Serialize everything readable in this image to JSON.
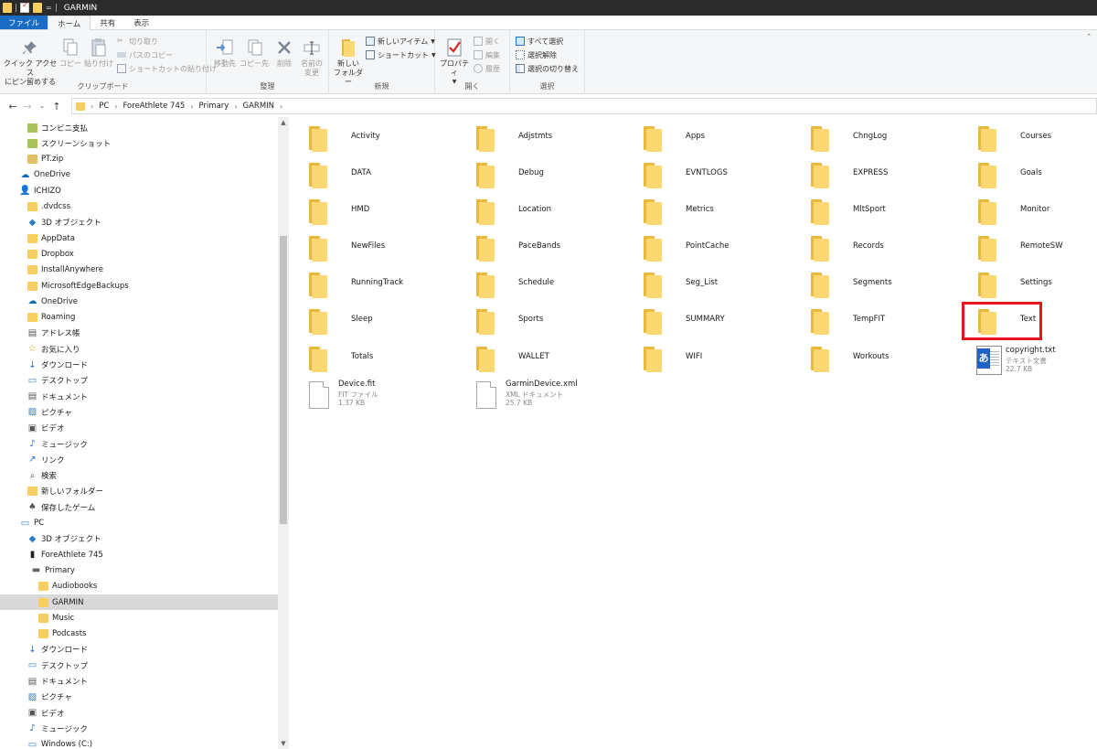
{
  "window": {
    "title": "GARMIN",
    "quick_access_down": "="
  },
  "tabs": [
    {
      "label": "ファイル"
    },
    {
      "label": "ホーム"
    },
    {
      "label": "共有"
    },
    {
      "label": "表示"
    }
  ],
  "ribbon": {
    "clipboard": {
      "label": "クリップボード",
      "pin": "クイック アクセス\nにピン留めする",
      "pin_line1": "クイック アクセス",
      "pin_line2": "にピン留めする",
      "copy": "コピー",
      "paste": "貼り付け",
      "cut": "切り取り",
      "copy_path": "パスのコピー",
      "paste_shortcut": "ショートカットの貼り付け"
    },
    "organize": {
      "label": "整理",
      "move_to": "移動先",
      "copy_to": "コピー先",
      "delete": "削除",
      "rename_line1": "名前の",
      "rename_line2": "変更"
    },
    "new": {
      "label": "新規",
      "new_folder_line1": "新しい",
      "new_folder_line2": "フォルダー",
      "new_item": "新しいアイテム",
      "shortcut": "ショートカット"
    },
    "open": {
      "label": "開く",
      "properties": "プロパティ",
      "open": "開く",
      "edit": "編集",
      "history": "履歴"
    },
    "select": {
      "label": "選択",
      "select_all": "すべて選択",
      "select_none": "選択解除",
      "invert": "選択の切り替え"
    }
  },
  "address": {
    "crumbs": [
      "PC",
      "ForeAthlete 745",
      "Primary",
      "GARMIN"
    ]
  },
  "nav": [
    {
      "label": "コンビニ支払",
      "icon": "file-icon"
    },
    {
      "label": "スクリーンショット",
      "icon": "file-icon"
    },
    {
      "label": "PT.zip",
      "icon": "zip-icon"
    },
    {
      "label": "OneDrive",
      "icon": "cloud-icon"
    },
    {
      "label": "ICHIZO",
      "icon": "user-icon"
    },
    {
      "label": ".dvdcss",
      "icon": "folder-icon"
    },
    {
      "label": "3D オブジェクト",
      "icon": "cube-icon"
    },
    {
      "label": "AppData",
      "icon": "folder-icon"
    },
    {
      "label": "Dropbox",
      "icon": "folder-icon"
    },
    {
      "label": "InstallAnywhere",
      "icon": "folder-icon"
    },
    {
      "label": "MicrosoftEdgeBackups",
      "icon": "folder-icon"
    },
    {
      "label": "OneDrive",
      "icon": "cloud-icon"
    },
    {
      "label": "Roaming",
      "icon": "folder-icon"
    },
    {
      "label": "アドレス帳",
      "icon": "contacts-icon"
    },
    {
      "label": "お気に入り",
      "icon": "star-icon"
    },
    {
      "label": "ダウンロード",
      "icon": "download-icon"
    },
    {
      "label": "デスクトップ",
      "icon": "desktop-icon"
    },
    {
      "label": "ドキュメント",
      "icon": "documents-icon"
    },
    {
      "label": "ピクチャ",
      "icon": "pictures-icon"
    },
    {
      "label": "ビデオ",
      "icon": "video-icon"
    },
    {
      "label": "ミュージック",
      "icon": "music-icon"
    },
    {
      "label": "リンク",
      "icon": "link-icon"
    },
    {
      "label": "検索",
      "icon": "search-icon"
    },
    {
      "label": "新しいフォルダー",
      "icon": "folder-icon"
    },
    {
      "label": "保存したゲーム",
      "icon": "game-icon"
    },
    {
      "label": "PC",
      "icon": "pc-icon"
    },
    {
      "label": "3D オブジェクト",
      "icon": "cube-icon"
    },
    {
      "label": "ForeAthlete 745",
      "icon": "device-icon"
    },
    {
      "label": "Primary",
      "icon": "drive-icon"
    },
    {
      "label": "Audiobooks",
      "icon": "folder-icon"
    },
    {
      "label": "GARMIN",
      "icon": "folder-icon",
      "selected": true
    },
    {
      "label": "Music",
      "icon": "folder-icon"
    },
    {
      "label": "Podcasts",
      "icon": "folder-icon"
    },
    {
      "label": "ダウンロード",
      "icon": "download-icon"
    },
    {
      "label": "デスクトップ",
      "icon": "desktop-icon"
    },
    {
      "label": "ドキュメント",
      "icon": "documents-icon"
    },
    {
      "label": "ピクチャ",
      "icon": "pictures-icon"
    },
    {
      "label": "ビデオ",
      "icon": "video-icon"
    },
    {
      "label": "ミュージック",
      "icon": "music-icon"
    },
    {
      "label": "Windows (C:)",
      "icon": "windows-drive-icon"
    }
  ],
  "folders": [
    "Activity",
    "Adjstmts",
    "Apps",
    "ChngLog",
    "Courses",
    "DATA",
    "Debug",
    "EVNTLOGS",
    "EXPRESS",
    "Goals",
    "HMD",
    "Location",
    "Metrics",
    "MltSport",
    "Monitor",
    "NewFiles",
    "PaceBands",
    "PointCache",
    "Records",
    "RemoteSW",
    "RunningTrack",
    "Schedule",
    "Seg_List",
    "Segments",
    "Settings",
    "Sleep",
    "Sports",
    "SUMMARY",
    "TempFIT",
    "Text",
    "Totals",
    "WALLET",
    "WIFI",
    "Workouts"
  ],
  "files": [
    {
      "name": "copyright.txt",
      "type": "テキスト文書",
      "size": "22.7 KB"
    },
    {
      "name": "Device.fit",
      "type": "FIT ファイル",
      "size": "1.37 KB"
    },
    {
      "name": "GarminDevice.xml",
      "type": "XML ドキュメント",
      "size": "25.7 KB"
    }
  ],
  "highlighted_folder": "Text",
  "colors": {
    "highlight": "#e8141a",
    "file_tab": "#1a6dc3",
    "folder": "#fcd873"
  }
}
